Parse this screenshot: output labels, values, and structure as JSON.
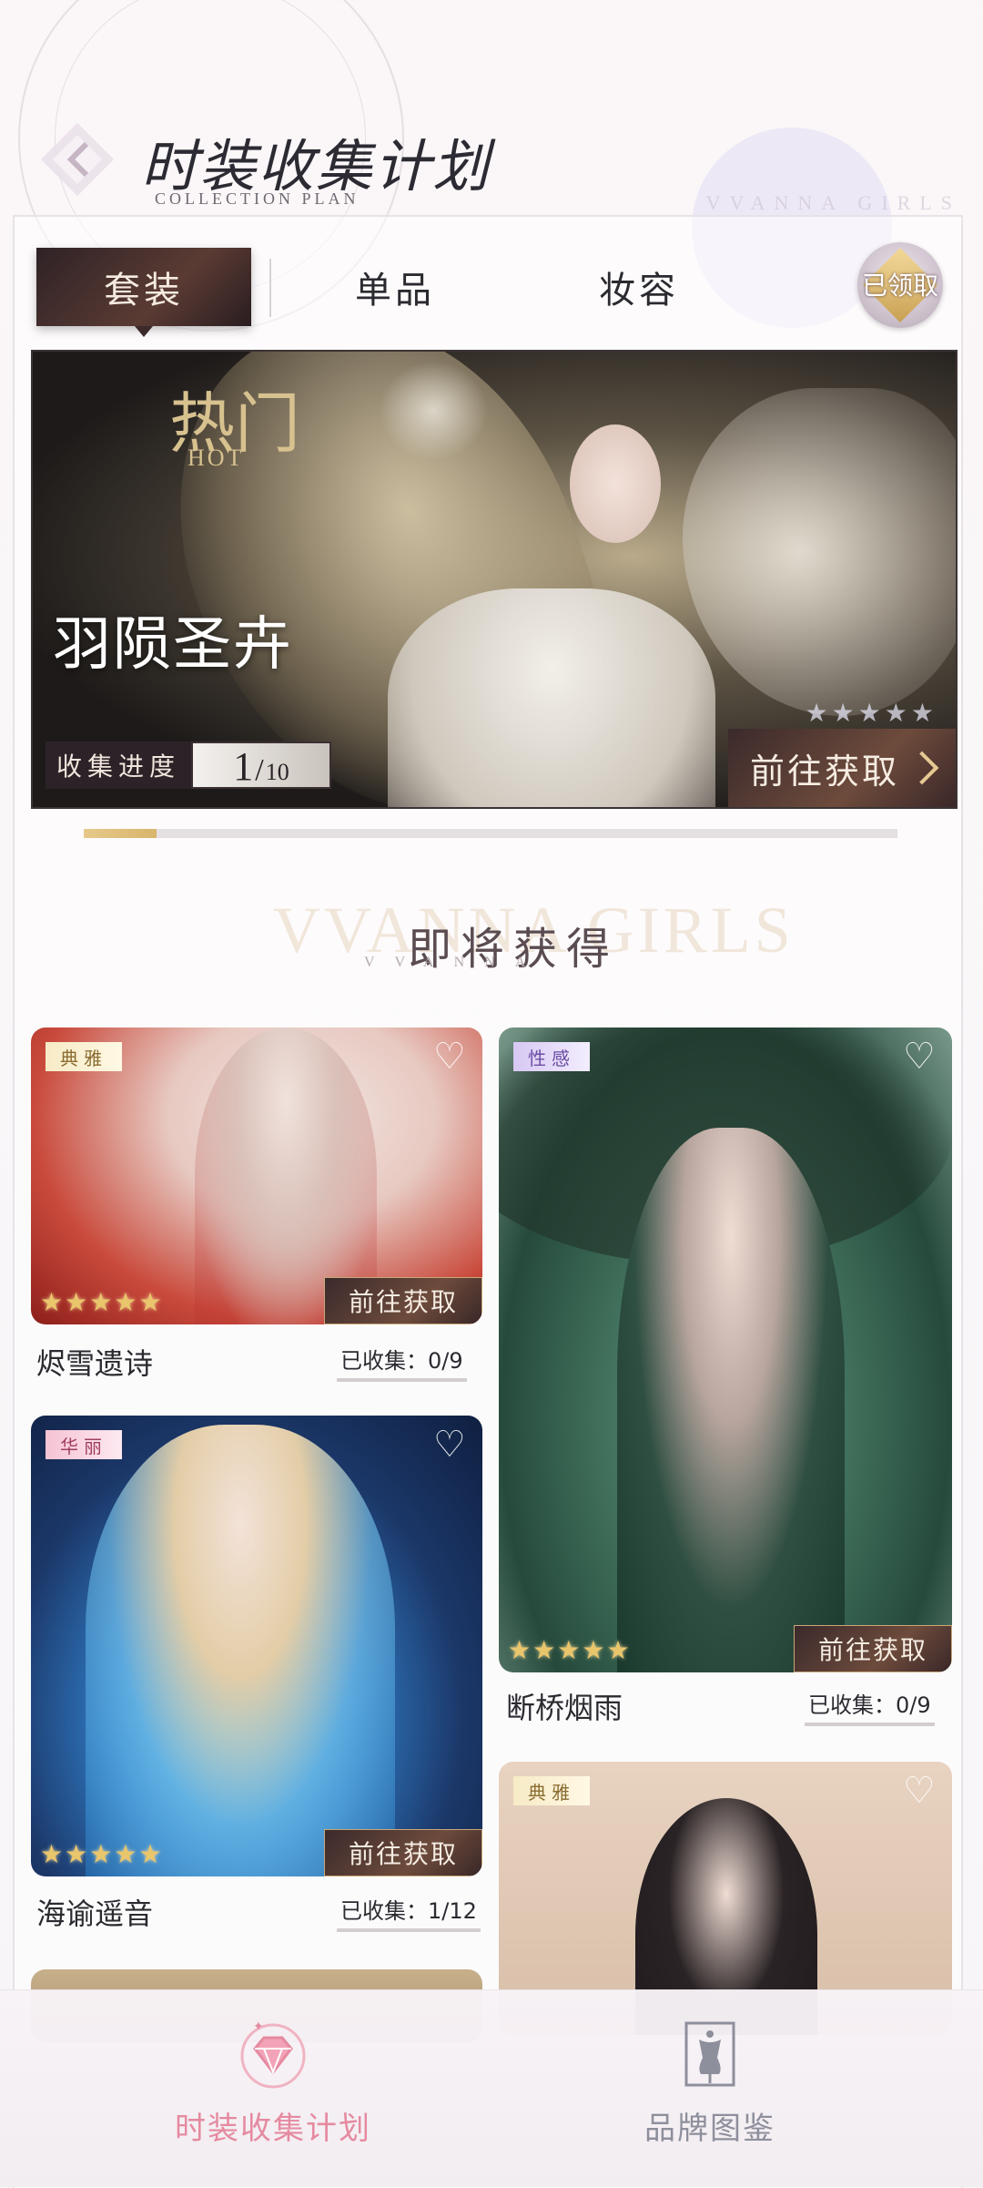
{
  "header": {
    "title": "时装收集计划",
    "subtitle": "COLLECTION PLAN",
    "watermark": "VVANNA GIRLS"
  },
  "tabs": [
    {
      "label": "套装",
      "active": true
    },
    {
      "label": "单品",
      "active": false
    },
    {
      "label": "妆容",
      "active": false
    }
  ],
  "claimed_badge": "已领取",
  "banner": {
    "hot_label": "热门",
    "hot_en": "HOT",
    "set_name": "羽陨圣卉",
    "progress_label": "收集进度",
    "progress_current": "1",
    "progress_total": "10",
    "goto_label": "前往获取",
    "stars": [
      "★",
      "★",
      "★",
      "★",
      "★"
    ]
  },
  "collection_progress": 0.09,
  "section": {
    "watermark": "VVANNA GIRLS",
    "title": "即将获得",
    "subtitle": "VVANNA"
  },
  "cards": [
    {
      "name": "烬雪遗诗",
      "tag": "典雅",
      "collected": "已收集：0/9",
      "goto": "前往获取",
      "stars": [
        "★",
        "★",
        "★",
        "★",
        "★"
      ]
    },
    {
      "name": "断桥烟雨",
      "tag": "性感",
      "collected": "已收集：0/9",
      "goto": "前往获取",
      "stars": [
        "★",
        "★",
        "★",
        "★",
        "★"
      ]
    },
    {
      "name": "海谕遥音",
      "tag": "华丽",
      "collected": "已收集：1/12",
      "goto": "前往获取",
      "stars": [
        "★",
        "★",
        "★",
        "★",
        "★"
      ]
    },
    {
      "name": "",
      "tag": "典雅",
      "collected": "",
      "goto": "",
      "stars": []
    }
  ],
  "heart_glyph": "♡",
  "bottom_nav": [
    {
      "label": "时装收集计划",
      "active": true,
      "icon": "diamond-icon",
      "color": "#e58aa0"
    },
    {
      "label": "品牌图鉴",
      "active": false,
      "icon": "mannequin-icon",
      "color": "#8e8f9c"
    }
  ]
}
